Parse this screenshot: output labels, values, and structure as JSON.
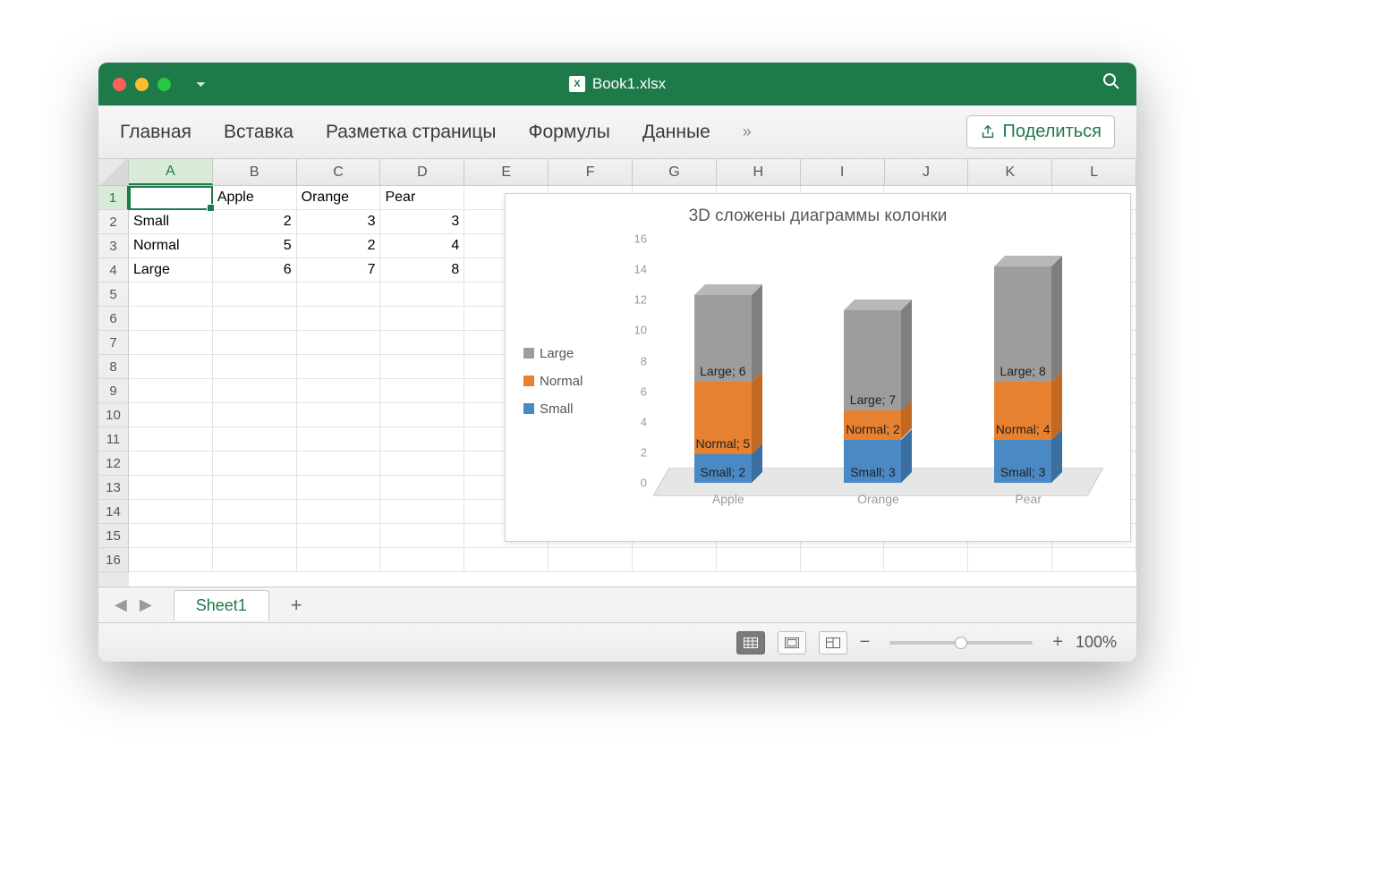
{
  "window": {
    "filename": "Book1.xlsx"
  },
  "ribbon": {
    "tabs": [
      "Главная",
      "Вставка",
      "Разметка страницы",
      "Формулы",
      "Данные"
    ],
    "more": "»",
    "share": "Поделиться"
  },
  "columns": [
    "A",
    "B",
    "C",
    "D",
    "E",
    "F",
    "G",
    "H",
    "I",
    "J",
    "K",
    "L"
  ],
  "rows_shown": 16,
  "active_cell": "A1",
  "table": {
    "headers": [
      "",
      "Apple",
      "Orange",
      "Pear"
    ],
    "rows": [
      {
        "label": "Small",
        "values": [
          2,
          3,
          3
        ]
      },
      {
        "label": "Normal",
        "values": [
          5,
          2,
          4
        ]
      },
      {
        "label": "Large",
        "values": [
          6,
          7,
          8
        ]
      }
    ]
  },
  "chart_data": {
    "type": "bar",
    "stacked": true,
    "three_d": true,
    "title": "3D сложены диаграммы колонки",
    "categories": [
      "Apple",
      "Orange",
      "Pear"
    ],
    "series": [
      {
        "name": "Small",
        "values": [
          2,
          3,
          3
        ],
        "color": "#4a89c4"
      },
      {
        "name": "Normal",
        "values": [
          5,
          2,
          4
        ],
        "color": "#e8812f"
      },
      {
        "name": "Large",
        "values": [
          6,
          7,
          8
        ],
        "color": "#9d9d9d"
      }
    ],
    "legend_order": [
      "Large",
      "Normal",
      "Small"
    ],
    "data_labels": [
      [
        "Small; 2",
        "Small; 3",
        "Small; 3"
      ],
      [
        "Normal; 5",
        "Normal; 2",
        "Normal; 4"
      ],
      [
        "Large; 6",
        "Large; 7",
        "Large; 8"
      ]
    ],
    "ylim": [
      0,
      16
    ],
    "yticks": [
      0,
      2,
      4,
      6,
      8,
      10,
      12,
      14,
      16
    ],
    "xlabel": "",
    "ylabel": ""
  },
  "sheet": {
    "name": "Sheet1"
  },
  "status": {
    "zoom": "100%",
    "zoom_minus": "−",
    "zoom_plus": "+"
  }
}
